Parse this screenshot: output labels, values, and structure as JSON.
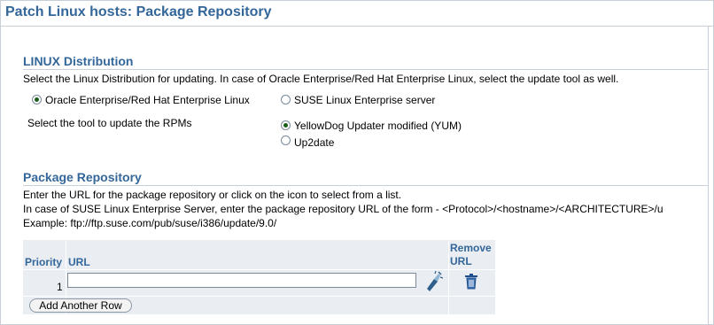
{
  "page_title": "Patch Linux hosts: Package Repository",
  "linux_section": {
    "heading": "LINUX Distribution",
    "instruction": "Select the Linux Distribution for updating. In case of Oracle Enterprise/Red Hat Enterprise Linux, select the update tool as well.",
    "options": [
      {
        "label": "Oracle Enterprise/Red Hat Enterprise Linux",
        "checked": true
      },
      {
        "label": "SUSE Linux Enterprise server",
        "checked": false
      }
    ],
    "tool_label": "Select the tool to update the RPMs",
    "tool_options": [
      {
        "label": "YellowDog Updater modified (YUM)",
        "checked": true
      },
      {
        "label": "Up2date",
        "checked": false
      }
    ]
  },
  "repo_section": {
    "heading": "Package Repository",
    "line1": "Enter the URL for the package repository or click on the icon to select from a list.",
    "line2": "In case of SUSE Linux Enterprise Server, enter the package repository URL of the form - <Protocol>/<hostname>/<ARCHITECTURE>/u",
    "line3": "Example: ftp://ftp.suse.com/pub/suse/i386/update/9.0/"
  },
  "table": {
    "headers": {
      "priority": "Priority",
      "url": "URL",
      "remove_line1": "Remove",
      "remove_line2": "URL"
    },
    "rows": [
      {
        "priority": "1",
        "url": ""
      }
    ],
    "add_row_label": "Add Another Row"
  },
  "icons": {
    "browse": "flashlight-search-icon",
    "remove": "trash-icon"
  }
}
